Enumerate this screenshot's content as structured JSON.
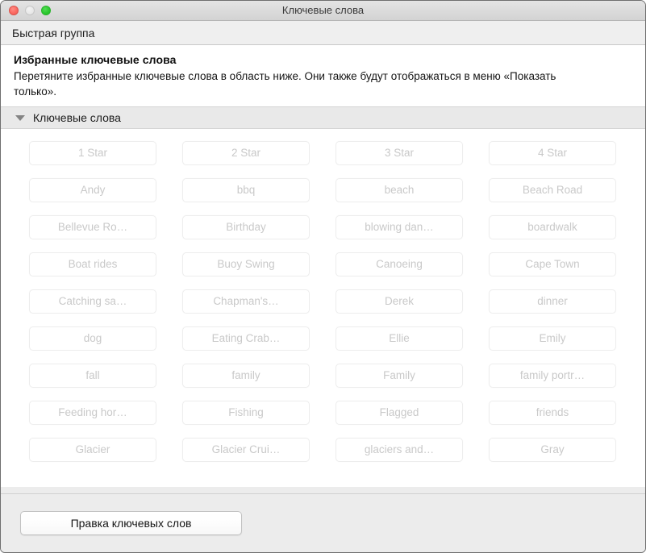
{
  "window": {
    "title": "Ключевые слова",
    "controls": {
      "close": "close-button",
      "minimize": "minimize-button",
      "zoom": "zoom-button"
    }
  },
  "toolbar": {
    "quick_group_label": "Быстрая группа"
  },
  "intro": {
    "heading": "Избранные ключевые слова",
    "body": "Перетяните избранные ключевые слова в область ниже. Они также будут отображаться в меню «Показать только»."
  },
  "section": {
    "title": "Ключевые слова",
    "expanded": true,
    "disclosure_icon": "triangle-down-icon"
  },
  "keywords": [
    "1 Star",
    "2 Star",
    "3 Star",
    "4 Star",
    "Andy",
    "bbq",
    "beach",
    "Beach Road",
    "Bellevue Ro…",
    "Birthday",
    "blowing dan…",
    "boardwalk",
    "Boat rides",
    "Buoy Swing",
    "Canoeing",
    "Cape Town",
    "Catching sa…",
    "Chapman's…",
    "Derek",
    "dinner",
    "dog",
    "Eating Crab…",
    "Ellie",
    "Emily",
    "fall",
    "family",
    "Family",
    "family portr…",
    "Feeding hor…",
    "Fishing",
    "Flagged",
    "friends",
    "Glacier",
    "Glacier Crui…",
    "glaciers and…",
    "Gray"
  ],
  "footer": {
    "edit_keywords_label": "Правка ключевых слов"
  },
  "colors": {
    "window_chrome": "#ececec",
    "titlebar_top": "#e4e4e4",
    "titlebar_bottom": "#d3d3d3",
    "close_light": "#fb6a62",
    "minimize_light": "#e8e8e8",
    "zoom_light": "#2cc82f",
    "section_header_bg": "#e9e9e9",
    "keyword_text": "#c9c9c9",
    "keyword_border": "#ededed",
    "content_bg": "#ffffff"
  }
}
